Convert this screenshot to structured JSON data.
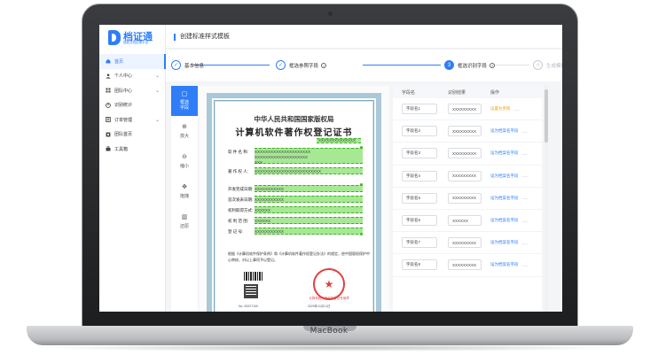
{
  "device": {
    "brand_label": "MacBook"
  },
  "app": {
    "logo_name": "档证通",
    "logo_sub": "智能文档处理平台",
    "page_title": "创建标准样式模板"
  },
  "sidebar": {
    "items": [
      {
        "label": "首页",
        "active": true,
        "arrow": ""
      },
      {
        "label": "个人中心",
        "active": false,
        "arrow": "⌄"
      },
      {
        "label": "团队中心",
        "active": false,
        "arrow": "⌄"
      },
      {
        "label": "识别统计",
        "active": false,
        "arrow": ""
      },
      {
        "label": "订单管理",
        "active": false,
        "arrow": "⌄"
      },
      {
        "label": "团队首页",
        "active": false,
        "arrow": ""
      },
      {
        "label": "工具箱",
        "active": false,
        "arrow": ""
      }
    ]
  },
  "steps": [
    {
      "label": "基本信息",
      "mark": "✓",
      "state": "done"
    },
    {
      "label": "框选参照字段",
      "mark": "✓",
      "state": "done"
    },
    {
      "label": "框选识别字段",
      "mark": "3",
      "state": "current"
    },
    {
      "label": "生成模板",
      "mark": "4",
      "state": "pending"
    }
  ],
  "tools": [
    {
      "label": "框选字段",
      "icon": "▢",
      "active": true
    },
    {
      "label": "放大",
      "icon": "⊕",
      "active": false
    },
    {
      "label": "缩小",
      "icon": "⊖",
      "active": false
    },
    {
      "label": "拖拽",
      "icon": "✥",
      "active": false
    },
    {
      "label": "还原",
      "icon": "▥",
      "active": false
    }
  ],
  "certificate": {
    "heading": "中华人民共和国国家版权局",
    "title": "计算机软件著作权登记证书",
    "top_value": "XXXXXXXXXXXXXX",
    "rows": [
      {
        "label": "软 件 名 称:",
        "value": "XXXXXXXXXXXXXXXXXXXXX"
      },
      {
        "label": "",
        "value": "XXXXXXXXXXXXXXXXXXXX"
      },
      {
        "label": "",
        "value": "XXX"
      },
      {
        "label": "著 作 权 人:",
        "value": "XXXXXXXXXXXXXXXXXXXXXXXXX"
      },
      {
        "label": "开发完成日期:",
        "value": "XXXXXXXXXXX"
      },
      {
        "label": "首次发表日期:",
        "value": "XXXXXXXXXXX"
      },
      {
        "label": "权利取得方式:",
        "value": "XXXXXX"
      },
      {
        "label": "权 利 范 围:",
        "value": "XXXXXX"
      },
      {
        "label": "登   记   号:",
        "value": "XXXXXXXXXXX"
      }
    ],
    "note": "根据《计算机软件保护条例》和《计算机软件著作权登记办法》的规定，经中国版权保护中心审核，对以上事项予以登记。",
    "seal_text": "计算机软件著作权登记专用章",
    "number": "No. 00227100",
    "date": "2020年11月11日"
  },
  "fields_table": {
    "headers": [
      "字段名",
      "识别结果",
      "操作"
    ],
    "rows": [
      {
        "name": "字段名1",
        "result": "XXXXXXXXX",
        "action": "设置为参照",
        "action_kind": "ref",
        "more": "...."
      },
      {
        "name": "字段名2",
        "result": "XXXXXXXXX",
        "action": "设为档案名字段",
        "action_kind": "link",
        "more": "...."
      },
      {
        "name": "字段名3",
        "result": "XXXXXXXXX",
        "action": "设为档案名字段",
        "action_kind": "link",
        "more": "...."
      },
      {
        "name": "字段名4",
        "result": "XXXXXXXXX",
        "action": "设为档案名字段",
        "action_kind": "link",
        "more": "...."
      },
      {
        "name": "字段名5",
        "result": "XXXXXXXXX",
        "action": "设为档案名字段",
        "action_kind": "link",
        "more": "...."
      },
      {
        "name": "字段名6",
        "result": "XXXXXX",
        "action": "设为档案名字段",
        "action_kind": "link",
        "more": "...."
      },
      {
        "name": "字段名7",
        "result": "XXXXXXXXX",
        "action": "设为档案名字段",
        "action_kind": "link",
        "more": "...."
      },
      {
        "name": "字段名8",
        "result": "XXXXXXXXX",
        "action": "设为档案名字段",
        "action_kind": "link",
        "more": "...."
      }
    ]
  },
  "colors": {
    "accent": "#2f7ef7",
    "highlight": "#5cd63c",
    "seal": "#e04040",
    "reference": "#f0a020"
  }
}
